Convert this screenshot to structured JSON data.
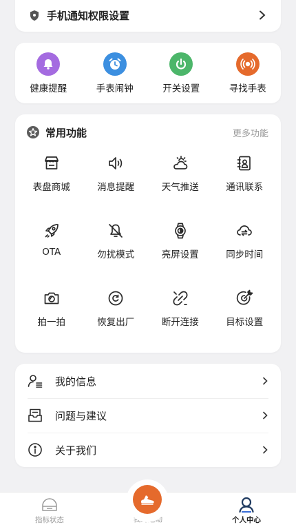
{
  "notify_card": {
    "title": "手机通知权限设置"
  },
  "quick_actions": [
    {
      "label": "健康提醒",
      "icon": "bell-icon",
      "color": "#a46be0"
    },
    {
      "label": "手表闹钟",
      "icon": "alarm-clock-icon",
      "color": "#3c8fe0"
    },
    {
      "label": "开关设置",
      "icon": "power-icon",
      "color": "#4cb66a"
    },
    {
      "label": "寻找手表",
      "icon": "find-watch-icon",
      "color": "#e56a2c"
    }
  ],
  "functions": {
    "title": "常用功能",
    "more": "更多功能",
    "items": [
      {
        "label": "表盘商城",
        "icon": "store-icon"
      },
      {
        "label": "消息提醒",
        "icon": "speaker-icon"
      },
      {
        "label": "天气推送",
        "icon": "weather-icon"
      },
      {
        "label": "通讯联系",
        "icon": "contacts-icon"
      },
      {
        "label": "OTA",
        "icon": "rocket-icon"
      },
      {
        "label": "勿扰模式",
        "icon": "bell-off-icon"
      },
      {
        "label": "亮屏设置",
        "icon": "watch-screen-icon"
      },
      {
        "label": "同步时间",
        "icon": "cloud-sync-icon"
      },
      {
        "label": "拍一拍",
        "icon": "camera-icon"
      },
      {
        "label": "恢复出厂",
        "icon": "reset-icon"
      },
      {
        "label": "断开连接",
        "icon": "unlink-icon"
      },
      {
        "label": "目标设置",
        "icon": "target-icon"
      }
    ]
  },
  "menu": [
    {
      "label": "我的信息",
      "icon": "user-info-icon"
    },
    {
      "label": "问题与建议",
      "icon": "feedback-icon"
    },
    {
      "label": "关于我们",
      "icon": "info-icon"
    }
  ],
  "tabbar": {
    "tabs": [
      {
        "label": "指标状态",
        "active": false
      },
      {
        "label": "我的运动",
        "active": false
      },
      {
        "label": "个人中心",
        "active": true
      }
    ]
  },
  "colors": {
    "accent": "#e56a2c",
    "icon_stroke": "#2b2b2b",
    "muted": "#9a9a9a"
  }
}
